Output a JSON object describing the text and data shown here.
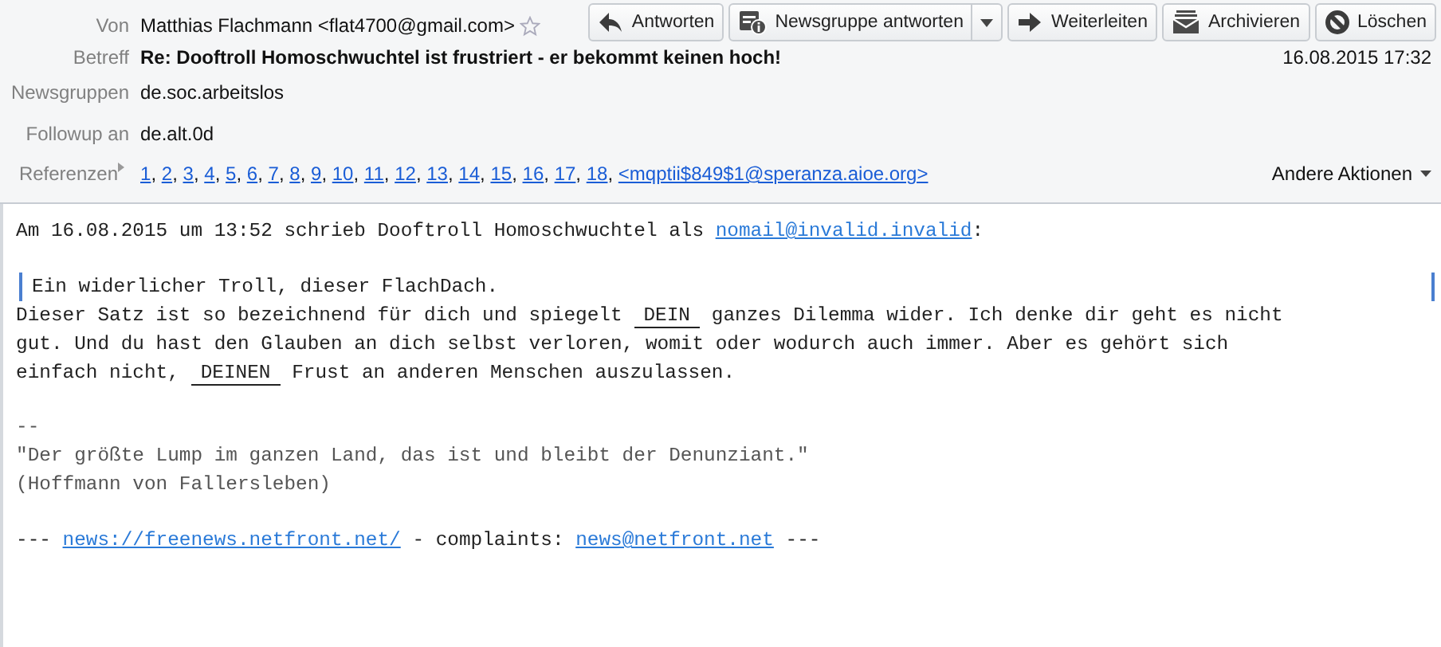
{
  "header": {
    "fields": [
      {
        "kind": "from",
        "label": "Von",
        "value": "Matthias Flachmann <flat4700@gmail.com>",
        "starred": false
      },
      {
        "kind": "subject",
        "label": "Betreff",
        "value": "Re: Dooftroll Homoschwuchtel ist frustriert - er bekommt keinen hoch!",
        "date": "16.08.2015 17:32"
      },
      {
        "kind": "plain",
        "label": "Newsgruppen",
        "value": "de.soc.arbeitslos"
      },
      {
        "kind": "plain",
        "label": "Followup an",
        "value": "de.alt.0d"
      },
      {
        "kind": "refs",
        "label": "Referenzen",
        "separator": ",",
        "refs": [
          "1",
          "2",
          "3",
          "4",
          "5",
          "6",
          "7",
          "8",
          "9",
          "10",
          "11",
          "12",
          "13",
          "14",
          "15",
          "16",
          "17",
          "18",
          "<mqptii$849$1@speranza.aioe.org>"
        ],
        "more": "Andere Aktionen"
      }
    ],
    "buttons": [
      {
        "kind": "reply",
        "label": "Antworten"
      },
      {
        "kind": "group",
        "label": "Newsgruppe antworten",
        "menu": true
      },
      {
        "kind": "forward",
        "label": "Weiterleiten"
      },
      {
        "kind": "archive",
        "label": "Archivieren"
      },
      {
        "kind": "delete",
        "label": "Löschen"
      }
    ]
  },
  "body": [
    {
      "kind": "text",
      "lines": [
        [
          {
            "kind": "plain",
            "text": "Am 16.08.2015 um 13:52 schrieb Dooftroll Homoschwuchtel als "
          },
          {
            "kind": "link",
            "text": "nomail@invalid.invalid"
          },
          {
            "kind": "plain",
            "text": ":"
          }
        ]
      ]
    },
    {
      "kind": "quote",
      "lines": [
        [
          {
            "kind": "plain",
            "text": "Ein widerlicher Troll, dieser FlachDach."
          }
        ]
      ]
    },
    {
      "kind": "text",
      "lines": [
        [
          {
            "kind": "plain",
            "text": "Dieser Satz ist so bezeichnend für dich und spiegelt "
          },
          {
            "kind": "underline",
            "text": "DEIN"
          },
          {
            "kind": "plain",
            "text": " ganzes Dilemma wider. Ich denke dir geht es nicht"
          }
        ],
        [
          {
            "kind": "plain",
            "text": "gut. Und du hast den Glauben an dich selbst verloren, womit oder wodurch auch immer. Aber es gehört sich"
          }
        ],
        [
          {
            "kind": "plain",
            "text": "einfach nicht, "
          },
          {
            "kind": "underline",
            "text": "DEINEN"
          },
          {
            "kind": "plain",
            "text": " Frust an anderen Menschen auszulassen."
          }
        ]
      ]
    },
    {
      "kind": "signature",
      "lines": [
        [
          {
            "kind": "plain",
            "text": "--"
          }
        ],
        [
          {
            "kind": "plain",
            "text": "\"Der größte Lump im ganzen Land, das ist und bleibt der Denunziant.\""
          }
        ],
        [
          {
            "kind": "plain",
            "text": "(Hoffmann von Fallersleben)"
          }
        ]
      ]
    },
    {
      "kind": "text",
      "lines": [
        [
          {
            "kind": "plain",
            "text": "--- "
          },
          {
            "kind": "link",
            "text": "news://freenews.netfront.net/"
          },
          {
            "kind": "plain",
            "text": " - complaints: "
          },
          {
            "kind": "link",
            "text": "news@netfront.net"
          },
          {
            "kind": "plain",
            "text": " ---"
          }
        ]
      ]
    }
  ]
}
